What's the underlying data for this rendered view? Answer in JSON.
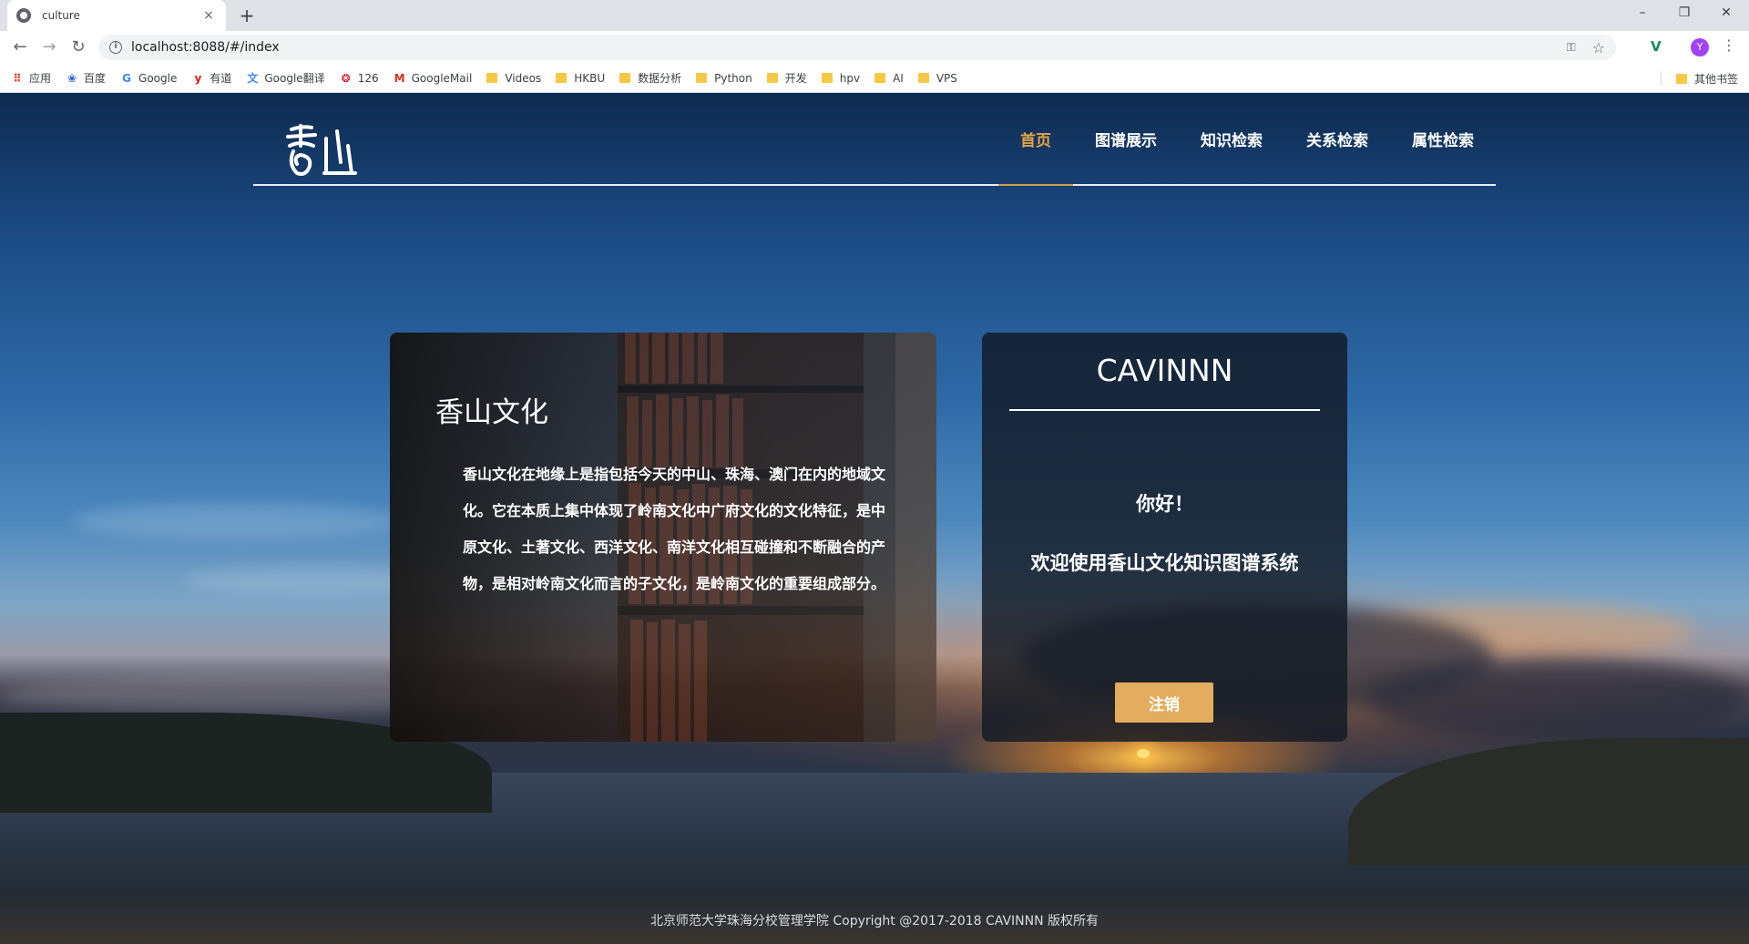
{
  "browser": {
    "tab_title": "culture",
    "tab_close": "×",
    "new_tab": "+",
    "url": "localhost:8088/#/index",
    "avatar_letter": "Y",
    "window_controls": {
      "minimize": "–",
      "restore": "❐",
      "close": "✕"
    }
  },
  "bookmarks": {
    "items": [
      {
        "label": "应用",
        "icon": "apps-grid-icon"
      },
      {
        "label": "百度",
        "icon": "baidu-paw-icon"
      },
      {
        "label": "Google",
        "icon": "google-g-icon"
      },
      {
        "label": "有道",
        "icon": "youdao-icon"
      },
      {
        "label": "Google翻译",
        "icon": "google-translate-icon"
      },
      {
        "label": "126",
        "icon": "netease-126-icon"
      },
      {
        "label": "GoogleMail",
        "icon": "gmail-icon"
      },
      {
        "label": "Videos",
        "icon": "folder-icon"
      },
      {
        "label": "HKBU",
        "icon": "folder-icon"
      },
      {
        "label": "数据分析",
        "icon": "folder-icon"
      },
      {
        "label": "Python",
        "icon": "folder-icon"
      },
      {
        "label": "开发",
        "icon": "folder-icon"
      },
      {
        "label": "hpv",
        "icon": "folder-icon"
      },
      {
        "label": "AI",
        "icon": "folder-icon"
      },
      {
        "label": "VPS",
        "icon": "folder-icon"
      }
    ],
    "other": "其他书签"
  },
  "header": {
    "nav": [
      {
        "label": "首页",
        "active": true
      },
      {
        "label": "图谱展示",
        "active": false
      },
      {
        "label": "知识检索",
        "active": false
      },
      {
        "label": "关系检索",
        "active": false
      },
      {
        "label": "属性检索",
        "active": false
      }
    ]
  },
  "culture_card": {
    "title": "香山文化",
    "body": "香山文化在地缘上是指包括今天的中山、珠海、澳门在内的地域文化。它在本质上集中体现了岭南文化中广府文化的文化特征，是中原文化、土著文化、西洋文化、南洋文化相互碰撞和不断融合的产物，是相对岭南文化而言的子文化，是岭南文化的重要组成部分。"
  },
  "user_card": {
    "username": "CAVINNN",
    "greeting": "你好！",
    "welcome": "欢迎使用香山文化知识图谱系统",
    "logout_label": "注销"
  },
  "footer": {
    "text": "北京师范大学珠海分校管理学院 Copyright @2017-2018 CAVINNN 版权所有"
  },
  "colors": {
    "nav_active": "#e6a542",
    "logout_button": "#e3ac5e",
    "card_dark": "#121a24"
  }
}
